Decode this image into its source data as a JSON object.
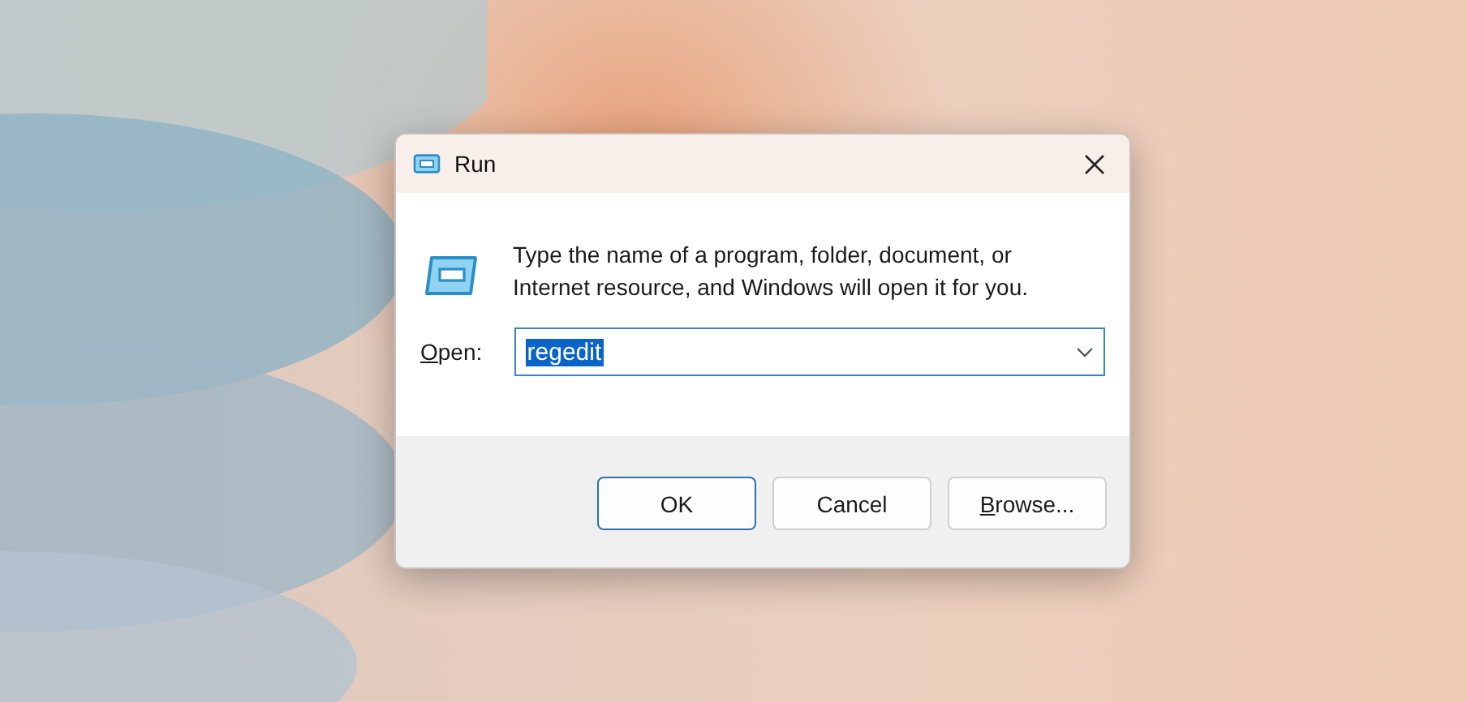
{
  "window": {
    "title": "Run"
  },
  "description": "Type the name of a program, folder, document, or Internet resource, and Windows will open it for you.",
  "open_field": {
    "label": {
      "access_key": "O",
      "rest": "pen:"
    },
    "value": "regedit",
    "text_selected": true
  },
  "buttons": [
    {
      "label": {
        "rest": "OK"
      },
      "default": true
    },
    {
      "label": {
        "rest": "Cancel"
      },
      "default": false
    },
    {
      "label": {
        "access_key": "B",
        "rest": "rowse..."
      },
      "default": false
    }
  ]
}
